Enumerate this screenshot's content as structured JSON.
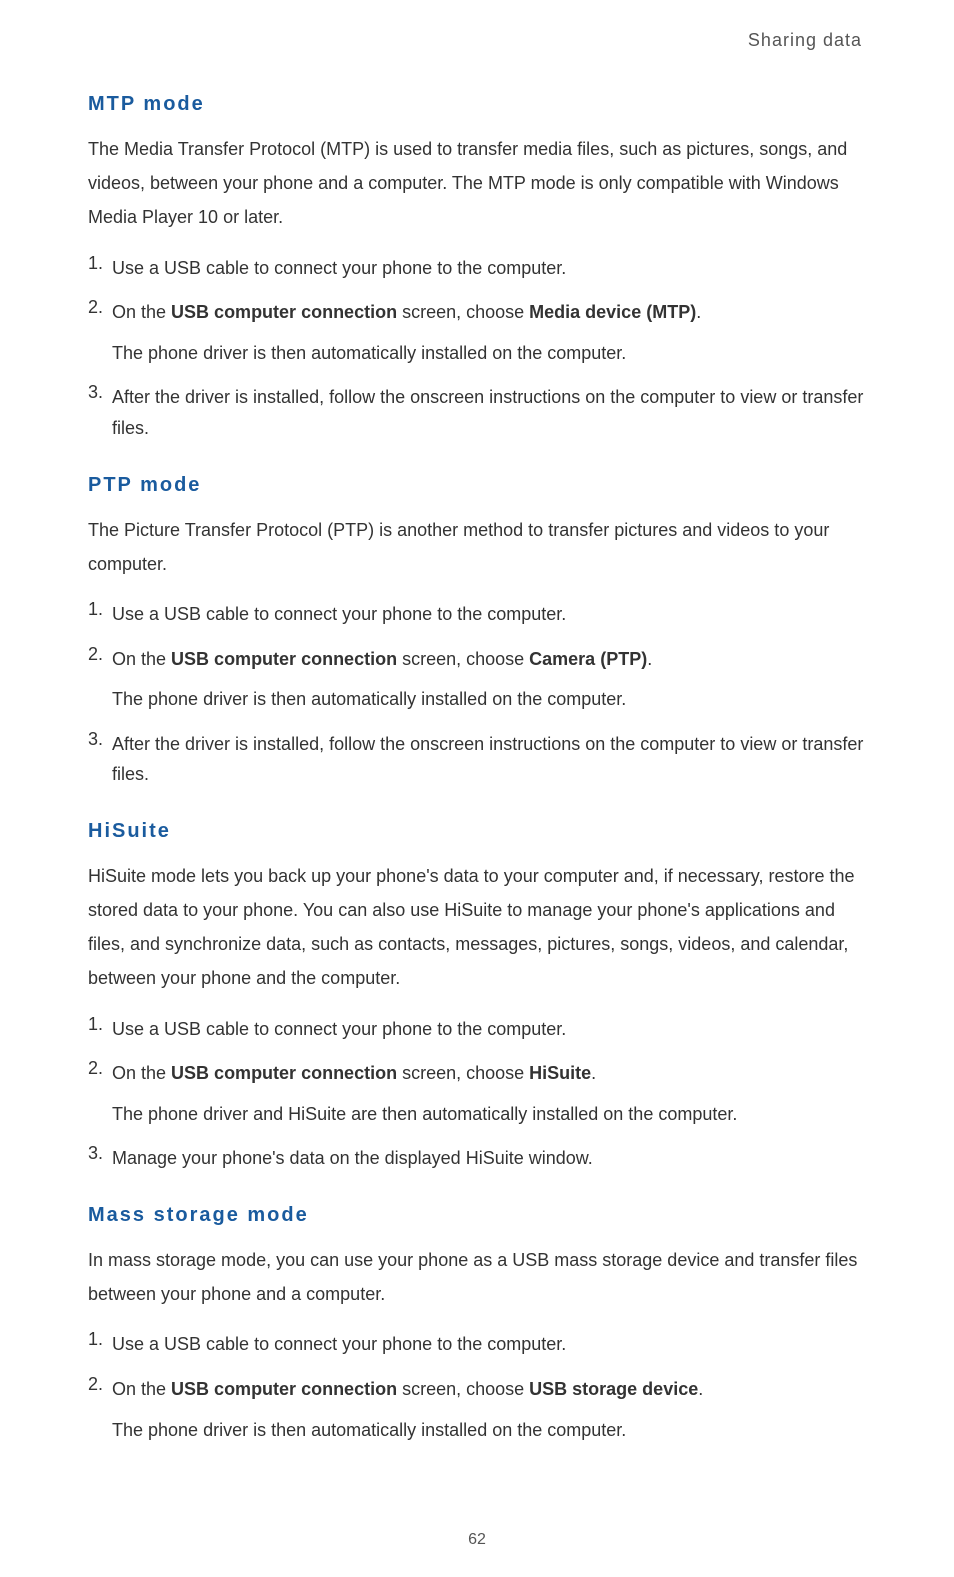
{
  "header": {
    "label": "Sharing data"
  },
  "footer": {
    "page_number": "62"
  },
  "mtp": {
    "title": "MTP  mode",
    "intro": "The Media Transfer Protocol (MTP) is used to transfer media files, such as pictures, songs, and videos, between your phone and a computer. The MTP mode is only compatible with Windows Media Player 10 or later.",
    "s1_num": "1.",
    "s1_text": "Use a USB cable to connect your phone to the computer.",
    "s2_num": "2.",
    "s2_pre": "On the ",
    "s2_b1": "USB computer connection",
    "s2_mid": " screen, choose ",
    "s2_b2": "Media device (MTP)",
    "s2_post": ".",
    "s2_sub": "The phone driver is then automatically installed on the computer.",
    "s3_num": "3.",
    "s3_text": "After the driver is installed, follow the onscreen instructions on the computer to view or transfer files."
  },
  "ptp": {
    "title": "PTP  mode",
    "intro": "The Picture Transfer Protocol (PTP) is another method to transfer pictures and videos to your computer.",
    "s1_num": "1.",
    "s1_text": "Use a USB cable to connect your phone to the computer.",
    "s2_num": "2.",
    "s2_pre": "On the ",
    "s2_b1": "USB computer connection",
    "s2_mid": " screen, choose ",
    "s2_b2": "Camera (PTP)",
    "s2_post": ".",
    "s2_sub": "The phone driver is then automatically installed on the computer.",
    "s3_num": "3.",
    "s3_text": "After the driver is installed, follow the onscreen instructions on the computer to view or transfer files."
  },
  "hisuite": {
    "title": "HiSuite",
    "intro": "HiSuite mode lets you back up your phone's data to your computer and, if necessary, restore the stored data to your phone. You can also use HiSuite to manage your phone's applications and files, and synchronize data, such as contacts, messages, pictures, songs, videos, and calendar, between your phone and the computer.",
    "s1_num": "1.",
    "s1_text": "Use a USB cable to connect your phone to the computer.",
    "s2_num": "2.",
    "s2_pre": "On the ",
    "s2_b1": "USB computer connection",
    "s2_mid": " screen, choose ",
    "s2_b2": "HiSuite",
    "s2_post": ".",
    "s2_sub": "The phone driver and HiSuite are then automatically installed on the computer.",
    "s3_num": "3.",
    "s3_text": "Manage your phone's data on the displayed HiSuite window."
  },
  "mass": {
    "title": "Mass  storage  mode",
    "intro": "In mass storage mode, you can use your phone as a USB mass storage device and transfer files between your phone and a computer.",
    "s1_num": "1.",
    "s1_text": "Use a USB cable to connect your phone to the computer.",
    "s2_num": "2.",
    "s2_pre": "On the ",
    "s2_b1": "USB computer connection",
    "s2_mid": " screen, choose ",
    "s2_b2": "USB storage device",
    "s2_post": ".",
    "s2_sub": "The phone driver is then automatically installed on the computer."
  }
}
